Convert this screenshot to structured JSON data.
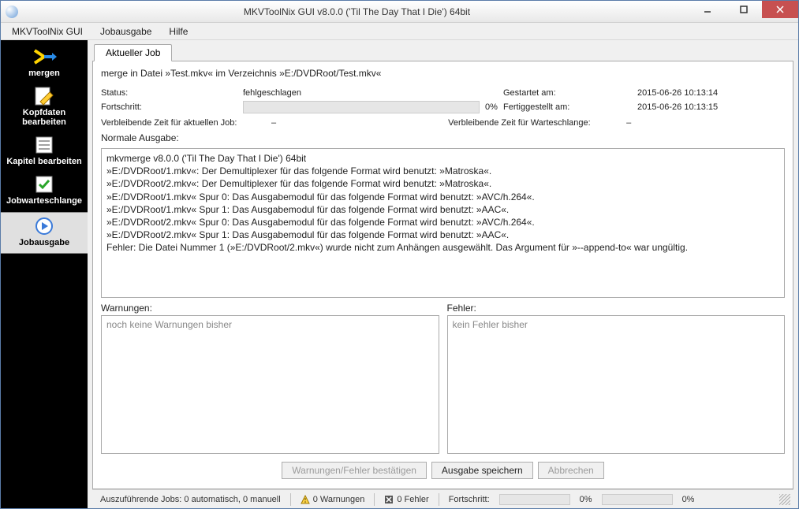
{
  "window": {
    "title": "MKVToolNix GUI v8.0.0 ('Til The Day That I Die') 64bit"
  },
  "menu": {
    "app": "MKVToolNix GUI",
    "job_output": "Jobausgabe",
    "help": "Hilfe"
  },
  "sidebar": {
    "merge": "mergen",
    "headers": "Kopfdaten bearbeiten",
    "chapters": "Kapitel bearbeiten",
    "queue": "Jobwarteschlange",
    "output": "Jobausgabe"
  },
  "tab": {
    "current": "Aktueller Job"
  },
  "desc": "merge in Datei »Test.mkv« im Verzeichnis »E:/DVDRoot/Test.mkv«",
  "info": {
    "status_k": "Status:",
    "status_v": "fehlgeschlagen",
    "progress_k": "Fortschritt:",
    "progress_v": "0%",
    "started_k": "Gestartet am:",
    "started_v": "2015-06-26 10:13:14",
    "finished_k": "Fertiggestellt am:",
    "finished_v": "2015-06-26 10:13:15",
    "remaining_job_k": "Verbleibende Zeit für aktuellen Job:",
    "remaining_job_v": "–",
    "remaining_queue_k": "Verbleibende Zeit für Warteschlange:",
    "remaining_queue_v": "–"
  },
  "output": {
    "label": "Normale Ausgabe:",
    "text": "mkvmerge v8.0.0 ('Til The Day That I Die') 64bit\n»E:/DVDRoot/1.mkv«: Der Demultiplexer für das folgende Format wird benutzt: »Matroska«.\n»E:/DVDRoot/2.mkv«: Der Demultiplexer für das folgende Format wird benutzt: »Matroska«.\n»E:/DVDRoot/1.mkv« Spur 0: Das Ausgabemodul für das folgende Format wird benutzt: »AVC/h.264«.\n»E:/DVDRoot/1.mkv« Spur 1: Das Ausgabemodul für das folgende Format wird benutzt: »AAC«.\n»E:/DVDRoot/2.mkv« Spur 0: Das Ausgabemodul für das folgende Format wird benutzt: »AVC/h.264«.\n»E:/DVDRoot/2.mkv« Spur 1: Das Ausgabemodul für das folgende Format wird benutzt: »AAC«.\nFehler: Die Datei Nummer 1 (»E:/DVDRoot/2.mkv«) wurde nicht zum Anhängen ausgewählt. Das Argument für »--append-to« war ungültig."
  },
  "warnings": {
    "label": "Warnungen:",
    "text": "noch keine Warnungen bisher"
  },
  "errors": {
    "label": "Fehler:",
    "text": "kein Fehler bisher"
  },
  "buttons": {
    "ack": "Warnungen/Fehler bestätigen",
    "save": "Ausgabe speichern",
    "abort": "Abbrechen"
  },
  "status": {
    "jobs": "Auszuführende Jobs:  0 automatisch, 0 manuell",
    "warn": "0 Warnungen",
    "err": "0 Fehler",
    "progress_k": "Fortschritt:",
    "p1": "0%",
    "p2": "0%"
  }
}
